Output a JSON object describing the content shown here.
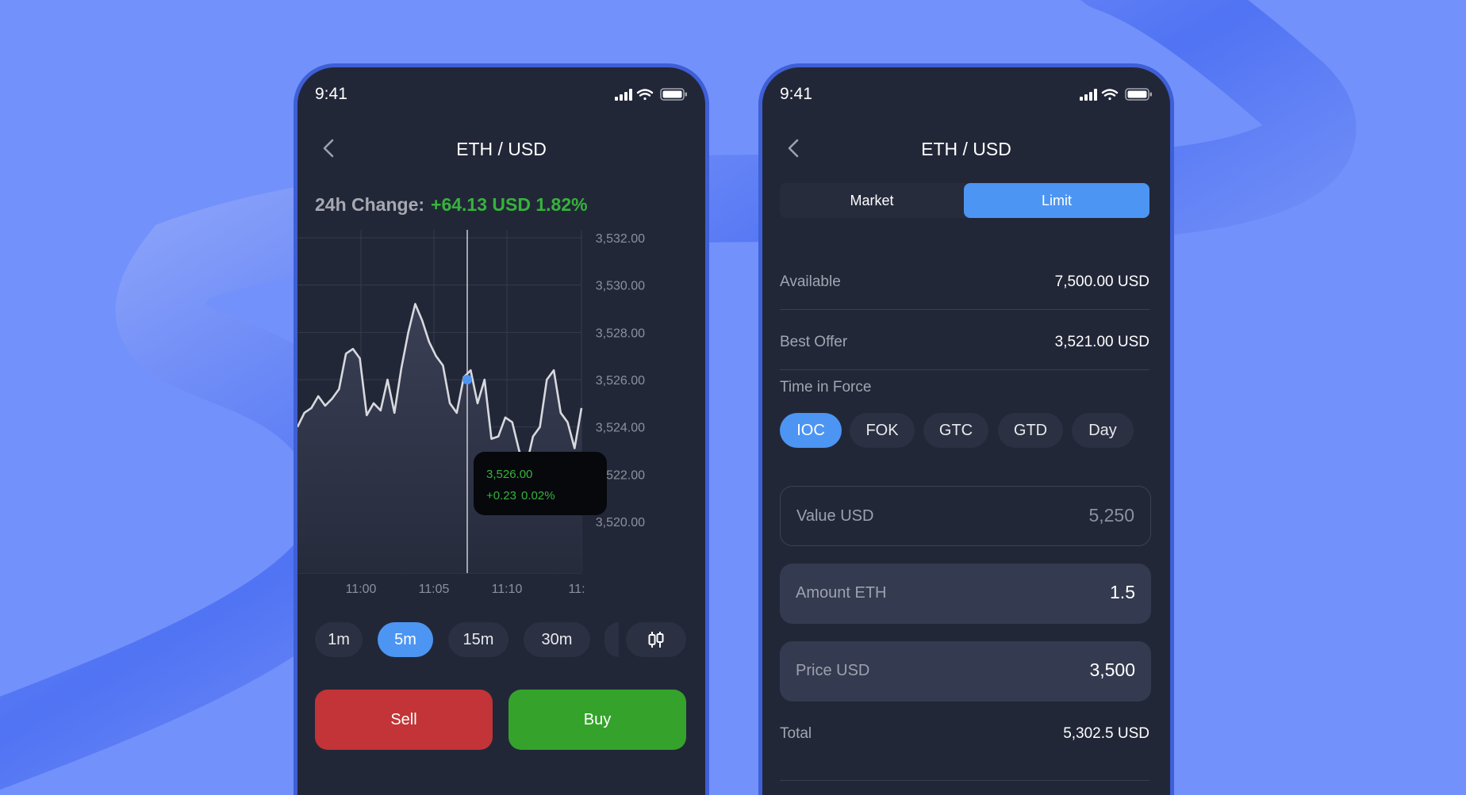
{
  "status": {
    "time": "9:41"
  },
  "phone1": {
    "title": "ETH / USD",
    "change_label": "24h Change:",
    "change_value": "+64.13 USD 1.82%",
    "timeframes": [
      "1m",
      "5m",
      "15m",
      "30m"
    ],
    "active_timeframe": "5m",
    "sell_label": "Sell",
    "buy_label": "Buy"
  },
  "chart_data": {
    "type": "line",
    "x_ticks": [
      "11:00",
      "11:05",
      "11:10",
      "11:"
    ],
    "y_ticks": [
      "3,532.00",
      "3,530.00",
      "3,528.00",
      "3,526.00",
      "3,524.00",
      "3,522.00",
      "3,520.00"
    ],
    "ylim": [
      3520,
      3532
    ],
    "grid": true,
    "series": [
      {
        "values": [
          3524.0,
          3524.6,
          3524.8,
          3525.3,
          3524.9,
          3525.2,
          3525.6,
          3527.1,
          3527.3,
          3526.9,
          3524.5,
          3525.0,
          3524.7,
          3526.0,
          3524.6,
          3526.5,
          3528.0,
          3529.2,
          3528.5,
          3527.6,
          3527.0,
          3526.6,
          3525.0,
          3524.6,
          3526.1,
          3526.4,
          3525.0,
          3526.0,
          3523.5,
          3523.6,
          3524.4,
          3524.2,
          3523.0,
          3522.3,
          3523.6,
          3524.0,
          3526.0,
          3526.4,
          3524.6,
          3524.2,
          3523.1,
          3524.8
        ]
      }
    ],
    "crosshair": {
      "price": "3,526.00",
      "change": "+0.23",
      "change_pct": "0.02%"
    }
  },
  "phone2": {
    "title": "ETH / USD",
    "order_types": [
      "Market",
      "Limit"
    ],
    "active_order_type": "Limit",
    "available_label": "Available",
    "available_value": "7,500.00 USD",
    "best_offer_label": "Best Offer",
    "best_offer_value": "3,521.00 USD",
    "tif_label": "Time in Force",
    "tif_options": [
      "IOC",
      "FOK",
      "GTC",
      "GTD",
      "Day"
    ],
    "active_tif": "IOC",
    "value_label": "Value USD",
    "value_value": "5,250",
    "amount_label": "Amount ETH",
    "amount_value": "1.5",
    "price_label": "Price USD",
    "price_value": "3,500",
    "total_label": "Total",
    "total_value": "5,302.5 USD"
  },
  "icons": [
    "back-chevron-icon",
    "signal-icon",
    "wifi-icon",
    "battery-icon",
    "candlestick-icon"
  ],
  "colors": {
    "background": "#7391fb",
    "panel": "#222738",
    "accent": "#4c95f3",
    "up": "#36b33b",
    "sell": "#c23437",
    "buy": "#35a32b"
  }
}
